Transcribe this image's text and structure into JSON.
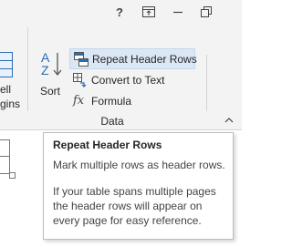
{
  "title_bar": {
    "help_label": "?",
    "icons": [
      "help-icon",
      "ribbon-display-options-icon",
      "minimize-icon",
      "restore-icon"
    ]
  },
  "left_partial": {
    "line1": "ell",
    "line2": "gins"
  },
  "data_group": {
    "sort_label": "Sort",
    "sort_icon_top": "A",
    "sort_icon_bottom": "Z",
    "commands": [
      {
        "label": "Repeat Header Rows",
        "icon": "repeat-header-rows-icon"
      },
      {
        "label": "Convert to Text",
        "icon": "convert-to-text-icon"
      },
      {
        "label": "Formula",
        "icon": "formula-icon"
      }
    ],
    "formula_glyph": "fx",
    "group_label": "Data"
  },
  "tooltip": {
    "title": "Repeat Header Rows",
    "line1": "Mark multiple rows as header rows.",
    "line2": "If your table spans multiple pages",
    "line3": "the header rows will appear on",
    "line4": "every page for easy reference."
  },
  "colors": {
    "accent": "#2b6cb0",
    "ribbon_bg": "#f3f3f3",
    "hover_bg": "#dbe7f5"
  }
}
